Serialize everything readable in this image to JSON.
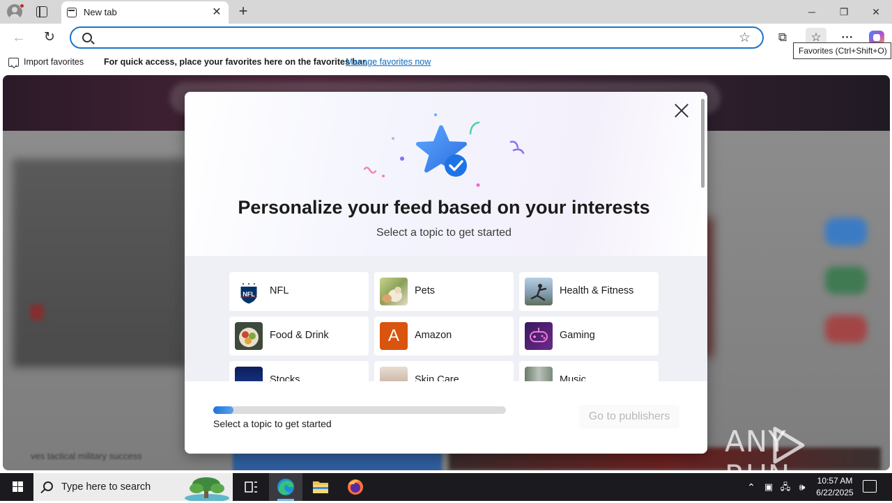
{
  "browser": {
    "tab_title": "New tab",
    "tooltip": "Favorites (Ctrl+Shift+O)"
  },
  "favorites_bar": {
    "import_label": "Import favorites",
    "message": "For quick access, place your favorites here on the favorites bar.",
    "manage_link": "Manage favorites now"
  },
  "background": {
    "blurred_headline": "ves tactical military success"
  },
  "modal": {
    "title": "Personalize your feed based on your interests",
    "subtitle": "Select a topic to get started",
    "topics": [
      {
        "label": "NFL",
        "icon": "nfl-logo-icon"
      },
      {
        "label": "Pets",
        "icon": "pets-photo"
      },
      {
        "label": "Health & Fitness",
        "icon": "fitness-photo"
      },
      {
        "label": "Food & Drink",
        "icon": "food-photo"
      },
      {
        "label": "Amazon",
        "icon": "amazon-letter-icon",
        "letter": "A"
      },
      {
        "label": "Gaming",
        "icon": "gamepad-icon"
      },
      {
        "label": "Stocks",
        "icon": "stocks-photo"
      },
      {
        "label": "Skin Care",
        "icon": "skincare-photo"
      },
      {
        "label": "Music",
        "icon": "music-photo"
      }
    ],
    "progress": 0.07,
    "footer_text": "Select a topic to get started",
    "go_button": "Go to publishers"
  },
  "watermark": {
    "text_left": "ANY",
    "text_right": "RUN"
  },
  "taskbar": {
    "search_placeholder": "Type here to search",
    "time": "10:57 AM",
    "date": "6/22/2025"
  },
  "colors": {
    "accent": "#1a73c8",
    "link": "#0f6cbd",
    "progress": "#1e74d6",
    "taskbar": "#1b1b1f"
  }
}
